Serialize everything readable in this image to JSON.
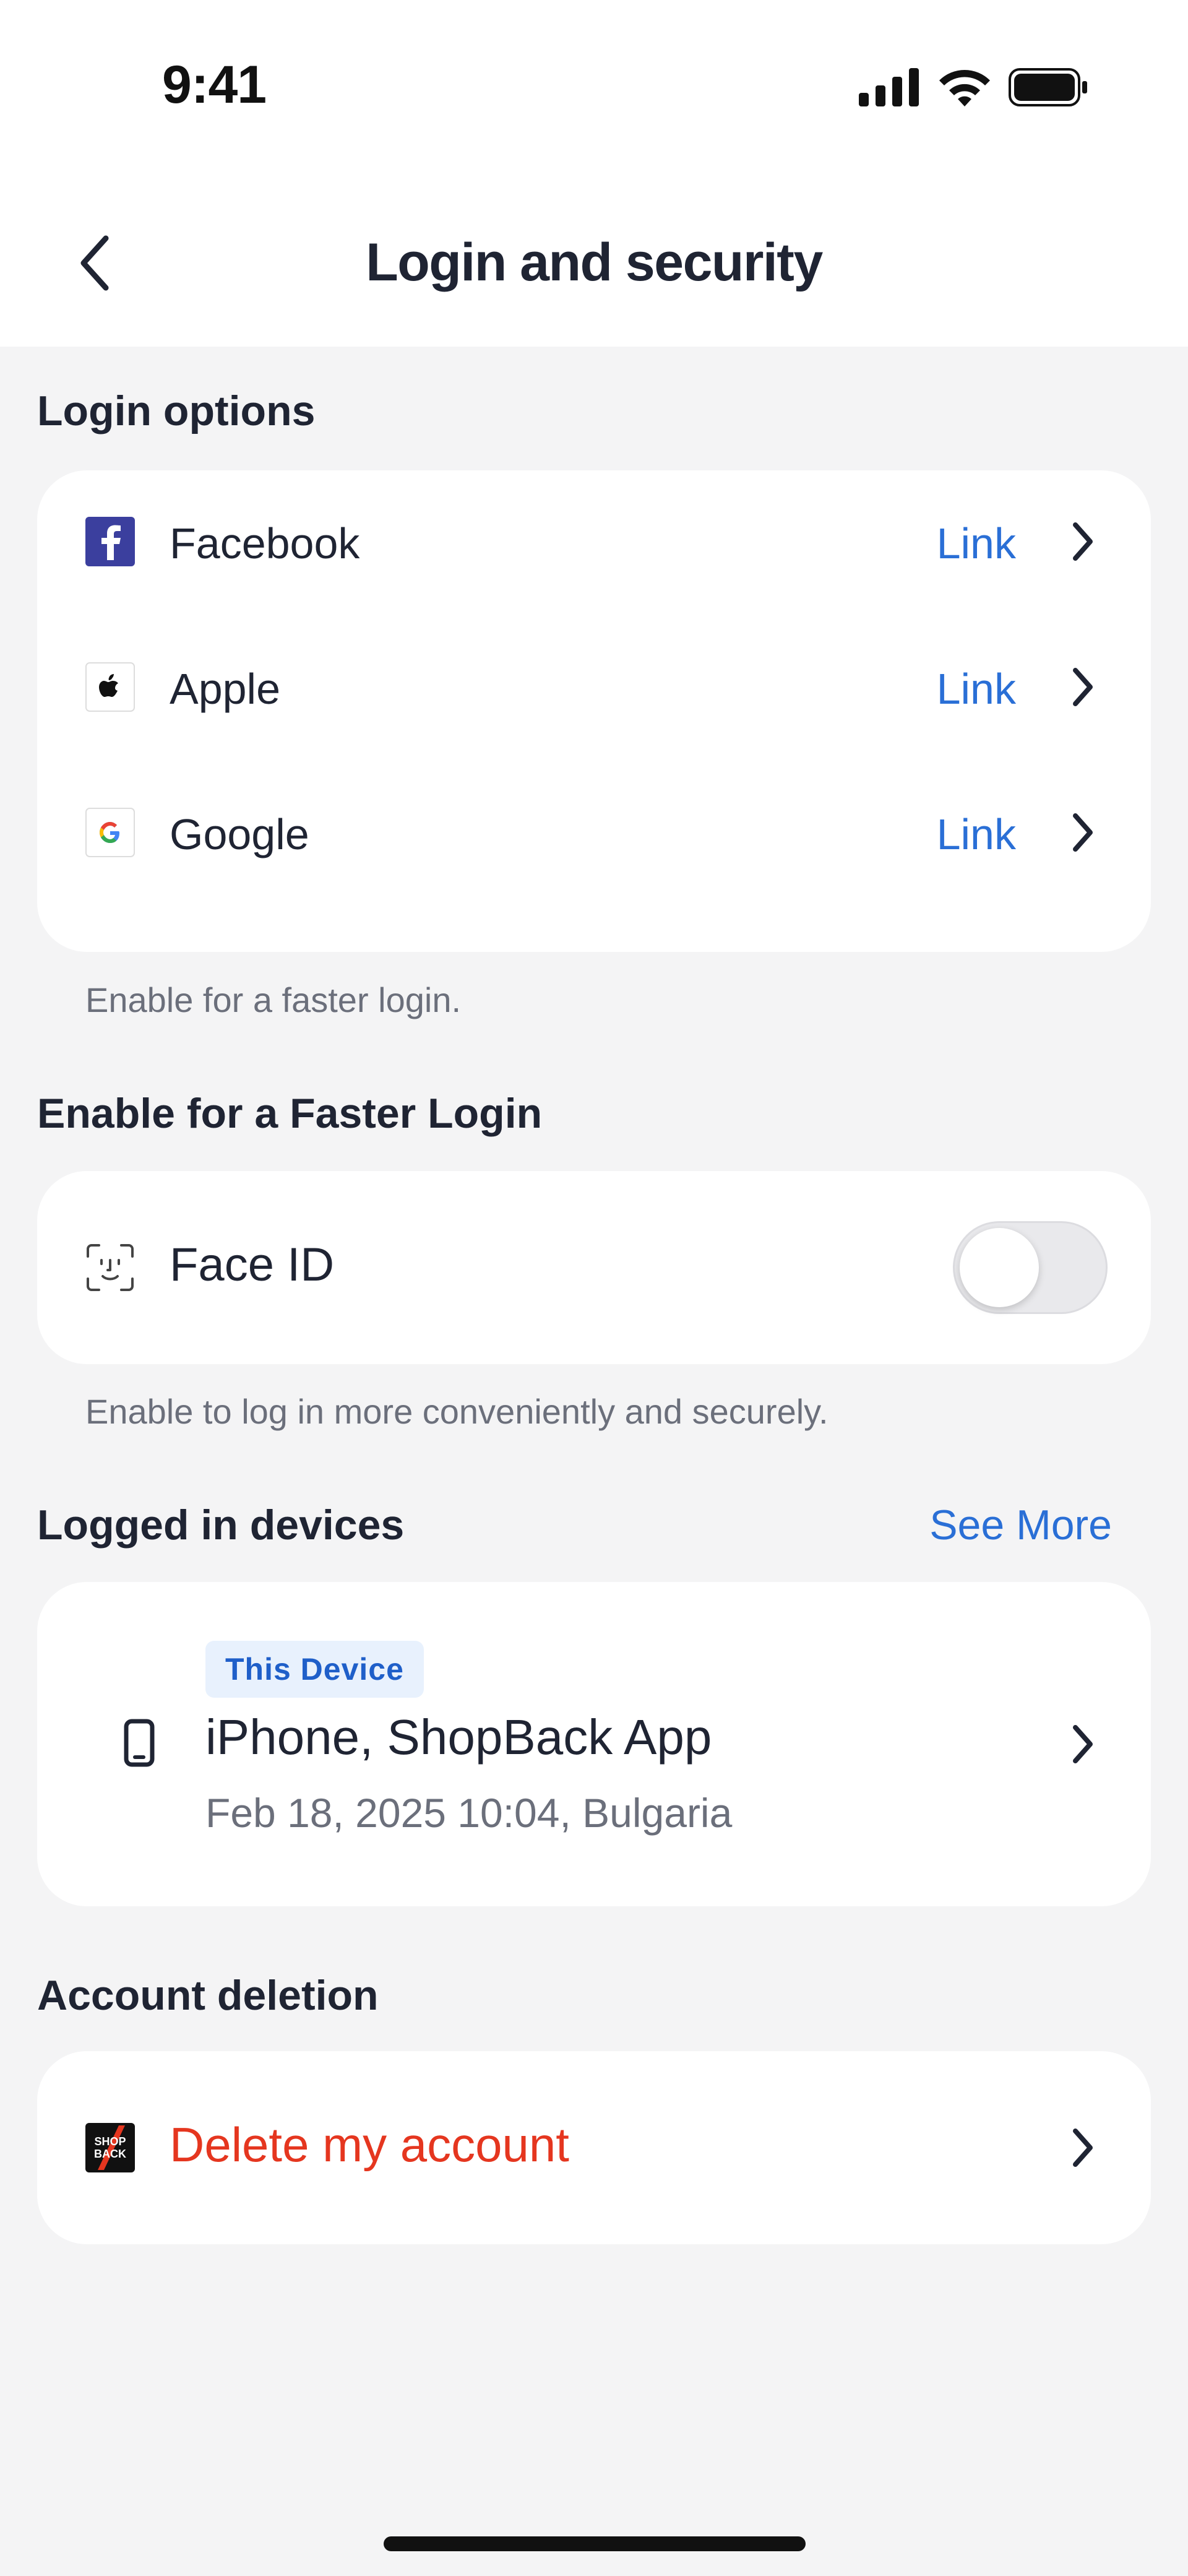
{
  "status_bar": {
    "time": "9:41"
  },
  "header": {
    "title": "Login and security"
  },
  "login_options": {
    "title": "Login options",
    "items": [
      {
        "label": "Facebook",
        "action": "Link",
        "icon": "facebook-icon"
      },
      {
        "label": "Apple",
        "action": "Link",
        "icon": "apple-icon"
      },
      {
        "label": "Google",
        "action": "Link",
        "icon": "google-icon"
      }
    ],
    "helper": "Enable for a faster login."
  },
  "faster_login": {
    "title": "Enable for a Faster Login",
    "face_id_label": "Face ID",
    "face_id_enabled": false,
    "helper": "Enable to log in more conveniently and securely."
  },
  "devices": {
    "title": "Logged in devices",
    "see_more": "See More",
    "items": [
      {
        "badge": "This Device",
        "name": "iPhone, ShopBack App",
        "meta": "Feb 18, 2025 10:04, Bulgaria"
      }
    ]
  },
  "account_deletion": {
    "title": "Account deletion",
    "delete_label": "Delete my account",
    "logo_text": [
      "SHOP",
      "BACK"
    ]
  },
  "colors": {
    "accent": "#2a6fd6",
    "danger": "#e5361f",
    "text": "#1f2433",
    "muted": "#6b6f7b",
    "background": "#f4f4f5",
    "facebook": "#3b3f9e"
  }
}
